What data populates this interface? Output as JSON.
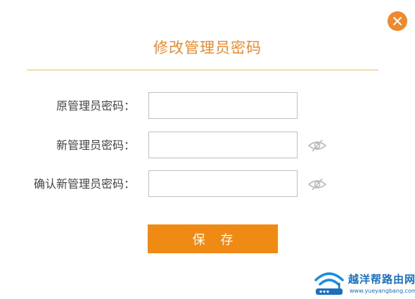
{
  "dialog": {
    "title": "修改管理员密码",
    "close_icon": "close-icon",
    "fields": [
      {
        "label": "原管理员密码：",
        "value": "",
        "has_eye_icon": false
      },
      {
        "label": "新管理员密码：",
        "value": "",
        "has_eye_icon": true,
        "eye_icon": "eye-hidden-icon"
      },
      {
        "label": "确认新管理员密码：",
        "value": "",
        "has_eye_icon": true,
        "eye_icon": "eye-hidden-icon"
      }
    ],
    "save_label": "保 存"
  },
  "watermark": {
    "name": "越洋帮路由网",
    "url": "www.yueyangbang.com"
  },
  "colors": {
    "accent": "#ec8a2a",
    "button": "#ef8a15",
    "divider": "#e9bd6e",
    "watermark": "#1a6fc1"
  }
}
